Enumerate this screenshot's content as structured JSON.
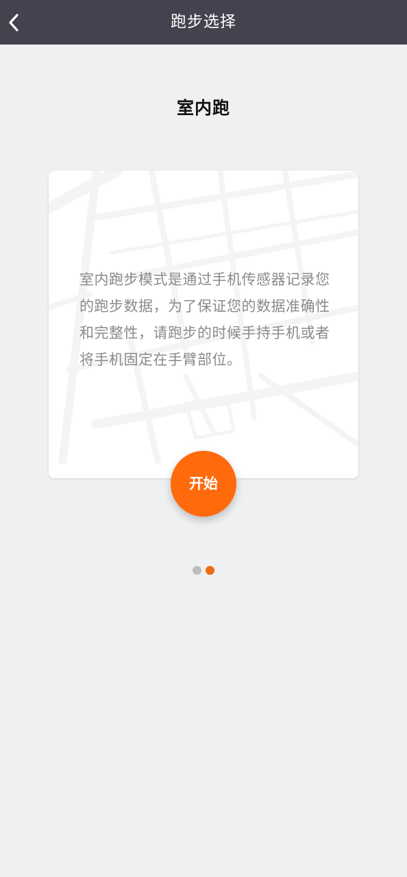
{
  "header": {
    "title": "跑步选择",
    "back_icon": "chevron-left-icon",
    "background_color": "#43434f"
  },
  "mode": {
    "title": "室内跑",
    "description": "室内跑步模式是通过手机传感器记录您的跑步数据，为了保证您的数据准确性和完整性，请跑步的时候手持手机或者将手机固定在手臂部位。",
    "start_label": "开始",
    "accent_color": "#ff6a0c"
  },
  "pager": {
    "total": 2,
    "active_index": 2,
    "active_color": "#f06a10",
    "inactive_color": "#bdbdbd"
  }
}
